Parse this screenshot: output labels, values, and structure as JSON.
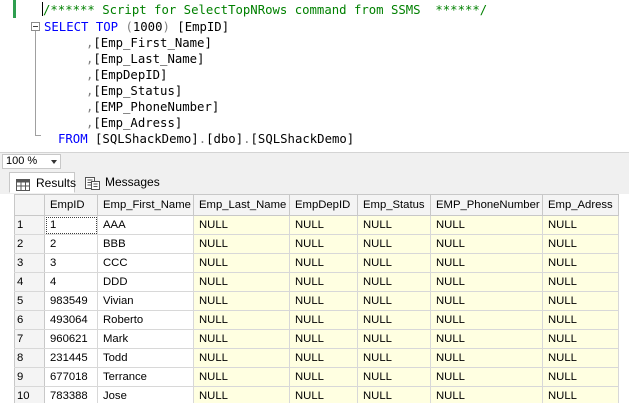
{
  "editor": {
    "lines": [
      {
        "kind": "comment",
        "text": "/****** Script for SelectTopNRows command from SSMS  ******/"
      },
      {
        "kind": "select",
        "kw_select": "SELECT",
        "kw_top": "TOP",
        "open": "(",
        "num": "1000",
        "close": ")",
        "rest": " [EmpID]"
      },
      {
        "kind": "col",
        "comma": ",",
        "text": "[Emp_First_Name]"
      },
      {
        "kind": "col",
        "comma": ",",
        "text": "[Emp_Last_Name]"
      },
      {
        "kind": "col",
        "comma": ",",
        "text": "[EmpDepID]"
      },
      {
        "kind": "col",
        "comma": ",",
        "text": "[Emp_Status]"
      },
      {
        "kind": "col",
        "comma": ",",
        "text": "[EMP_PhoneNumber]"
      },
      {
        "kind": "col",
        "comma": ",",
        "text": "[Emp_Adress]"
      },
      {
        "kind": "from",
        "kw_from": "FROM",
        "p1": "[SQLShackDemo]",
        "dot1": ".",
        "p2": "[dbo]",
        "dot2": ".",
        "p3": "[SQLShackDemo]"
      }
    ]
  },
  "zoom": {
    "value": "100 %"
  },
  "tabs": {
    "results_label": "Results",
    "messages_label": "Messages"
  },
  "grid": {
    "columns": [
      "",
      "EmpID",
      "Emp_First_Name",
      "Emp_Last_Name",
      "EmpDepID",
      "Emp_Status",
      "EMP_PhoneNumber",
      "Emp_Adress"
    ],
    "rows": [
      [
        "1",
        "1",
        "AAA",
        "NULL",
        "NULL",
        "NULL",
        "NULL",
        "NULL"
      ],
      [
        "2",
        "2",
        "BBB",
        "NULL",
        "NULL",
        "NULL",
        "NULL",
        "NULL"
      ],
      [
        "3",
        "3",
        "CCC",
        "NULL",
        "NULL",
        "NULL",
        "NULL",
        "NULL"
      ],
      [
        "4",
        "4",
        "DDD",
        "NULL",
        "NULL",
        "NULL",
        "NULL",
        "NULL"
      ],
      [
        "5",
        "983549",
        "Vivian",
        "NULL",
        "NULL",
        "NULL",
        "NULL",
        "NULL"
      ],
      [
        "6",
        "493064",
        "Roberto",
        "NULL",
        "NULL",
        "NULL",
        "NULL",
        "NULL"
      ],
      [
        "7",
        "960621",
        "Mark",
        "NULL",
        "NULL",
        "NULL",
        "NULL",
        "NULL"
      ],
      [
        "8",
        "231445",
        "Todd",
        "NULL",
        "NULL",
        "NULL",
        "NULL",
        "NULL"
      ],
      [
        "9",
        "677018",
        "Terrance",
        "NULL",
        "NULL",
        "NULL",
        "NULL",
        "NULL"
      ],
      [
        "10",
        "783388",
        "Jose",
        "NULL",
        "NULL",
        "NULL",
        "NULL",
        "NULL"
      ]
    ]
  },
  "colors": {
    "comment": "#008000",
    "keyword": "#0000ff",
    "operator": "#808080",
    "null_cell_bg": "#ffffe1"
  }
}
